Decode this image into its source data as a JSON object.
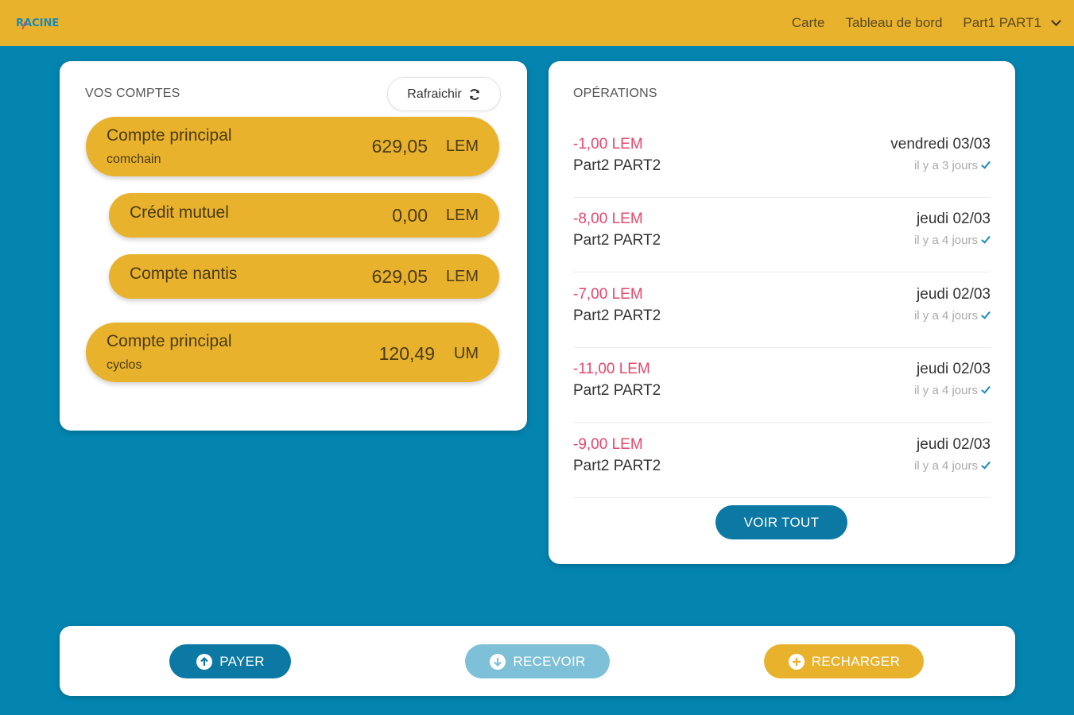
{
  "header": {
    "logo": "RACINE",
    "nav": [
      "Carte",
      "Tableau de bord"
    ],
    "user": "Part1 PART1"
  },
  "accounts": {
    "title": "VOS COMPTES",
    "refresh_label": "Rafraichir",
    "items": [
      {
        "name": "Compte principal",
        "sub": "comchain",
        "amount": "629,05",
        "currency": "LEM"
      },
      {
        "name": "Crédit mutuel",
        "sub": "",
        "amount": "0,00",
        "currency": "LEM"
      },
      {
        "name": "Compte nantis",
        "sub": "",
        "amount": "629,05",
        "currency": "LEM"
      },
      {
        "name": "Compte principal",
        "sub": "cyclos",
        "amount": "120,49",
        "currency": "UM"
      }
    ]
  },
  "operations": {
    "title": "OPÉRATIONS",
    "items": [
      {
        "amount": "-1,00 LEM",
        "party": "Part2 PART2",
        "date": "vendredi 03/03",
        "ago": "il y a 3 jours"
      },
      {
        "amount": "-8,00 LEM",
        "party": "Part2 PART2",
        "date": "jeudi 02/03",
        "ago": "il y a 4 jours"
      },
      {
        "amount": "-7,00 LEM",
        "party": "Part2 PART2",
        "date": "jeudi 02/03",
        "ago": "il y a 4 jours"
      },
      {
        "amount": "-11,00 LEM",
        "party": "Part2 PART2",
        "date": "jeudi 02/03",
        "ago": "il y a 4 jours"
      },
      {
        "amount": "-9,00 LEM",
        "party": "Part2 PART2",
        "date": "jeudi 02/03",
        "ago": "il y a 4 jours"
      }
    ],
    "see_all_label": "VOIR TOUT"
  },
  "actions": {
    "pay_label": "PAYER",
    "receive_label": "RECEVOIR",
    "reload_label": "RECHARGER"
  },
  "colors": {
    "background": "#0385b0",
    "accent_yellow": "#e8b22d",
    "primary_blue": "#0b79a3",
    "disabled_blue": "#7dc0d8",
    "negative_red": "#e8466a"
  },
  "icons": {
    "refresh": "refresh-icon",
    "check": "check-icon",
    "pay": "arrow-up-circle-icon",
    "receive": "arrow-down-circle-icon",
    "reload": "plus-circle-icon",
    "user_menu": "chevron-down-icon"
  }
}
